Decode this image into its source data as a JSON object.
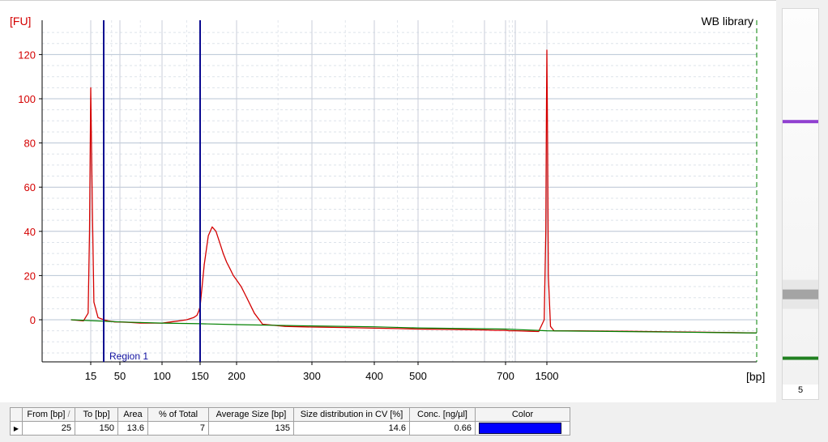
{
  "chart_data": {
    "type": "line",
    "title": "WB library",
    "ylabel": "[FU]",
    "xlabel": "[bp]",
    "ylim": [
      -18,
      135
    ],
    "y_ticks": [
      0,
      20,
      40,
      60,
      80,
      100,
      120
    ],
    "x_tick_labels": [
      "15",
      "50",
      "100",
      "150",
      "200",
      "300",
      "400",
      "500",
      "700",
      "1500"
    ],
    "x_scale": "ladder (non-linear)",
    "series": [
      {
        "color": "#d40000",
        "x": [
          5,
          10,
          13,
          14,
          15,
          16,
          17,
          20,
          25,
          30,
          40,
          50,
          60,
          70,
          80,
          90,
          100,
          110,
          120,
          130,
          140,
          145,
          148,
          150,
          155,
          160,
          165,
          170,
          175,
          180,
          185,
          190,
          195,
          200,
          205,
          210,
          215,
          220,
          230,
          260,
          300,
          350,
          400,
          450,
          500,
          550,
          600,
          650,
          700,
          800,
          1000,
          1200,
          1350,
          1450,
          1480,
          1490,
          1500,
          1510,
          1520,
          1550,
          1600,
          2000,
          3000,
          5000,
          8000,
          10000
        ],
        "y": [
          0,
          -0.5,
          3,
          40,
          105,
          50,
          8,
          1,
          0,
          -0.5,
          -1,
          -1,
          -1.2,
          -1.5,
          -1.5,
          -1.5,
          -1.5,
          -1,
          -0.5,
          0,
          1,
          2,
          4,
          6,
          25,
          38,
          42,
          40,
          35,
          30,
          26,
          23,
          20,
          18,
          15,
          11,
          7,
          3,
          -2,
          -3,
          -3.3,
          -3.5,
          -3.8,
          -4,
          -4.2,
          -4.4,
          -4.6,
          -4.8,
          -4.8,
          -5,
          -5,
          -5.2,
          -5.3,
          0,
          40,
          90,
          122,
          80,
          20,
          -3,
          -5,
          -5,
          -5.2,
          -5.5,
          -5.8,
          -6
        ]
      },
      {
        "color": "#008000",
        "x": [
          5,
          50,
          100,
          150,
          200,
          300,
          400,
          500,
          700,
          1500,
          5000,
          10000
        ],
        "y": [
          0,
          -1,
          -1.5,
          -1.8,
          -2.2,
          -2.8,
          -3.2,
          -3.7,
          -4.2,
          -5,
          -5.6,
          -6
        ]
      }
    ],
    "region_markers_bp": [
      25,
      150
    ],
    "annotations": [
      "Region 1"
    ],
    "grid": true,
    "legend": "none"
  },
  "gel": {
    "lane_number": "5",
    "bands": [
      {
        "position": 0.3,
        "color": "#9040d0"
      },
      {
        "position": 0.76,
        "color": "#888888"
      },
      {
        "position": 0.93,
        "color": "#208020"
      }
    ]
  },
  "table": {
    "headers": [
      "From [bp]",
      "To [bp]",
      "Area",
      "% of Total",
      "Average Size [bp]",
      "Size distribution in CV [%]",
      "Conc. [ng/µl]",
      "Color"
    ],
    "sort_indicator": "/",
    "rows": [
      {
        "from": "25",
        "to": "150",
        "area": "13.6",
        "pct": "7",
        "avg": "135",
        "cv": "14.6",
        "conc": "0.66",
        "color": "#0000ff"
      }
    ]
  }
}
